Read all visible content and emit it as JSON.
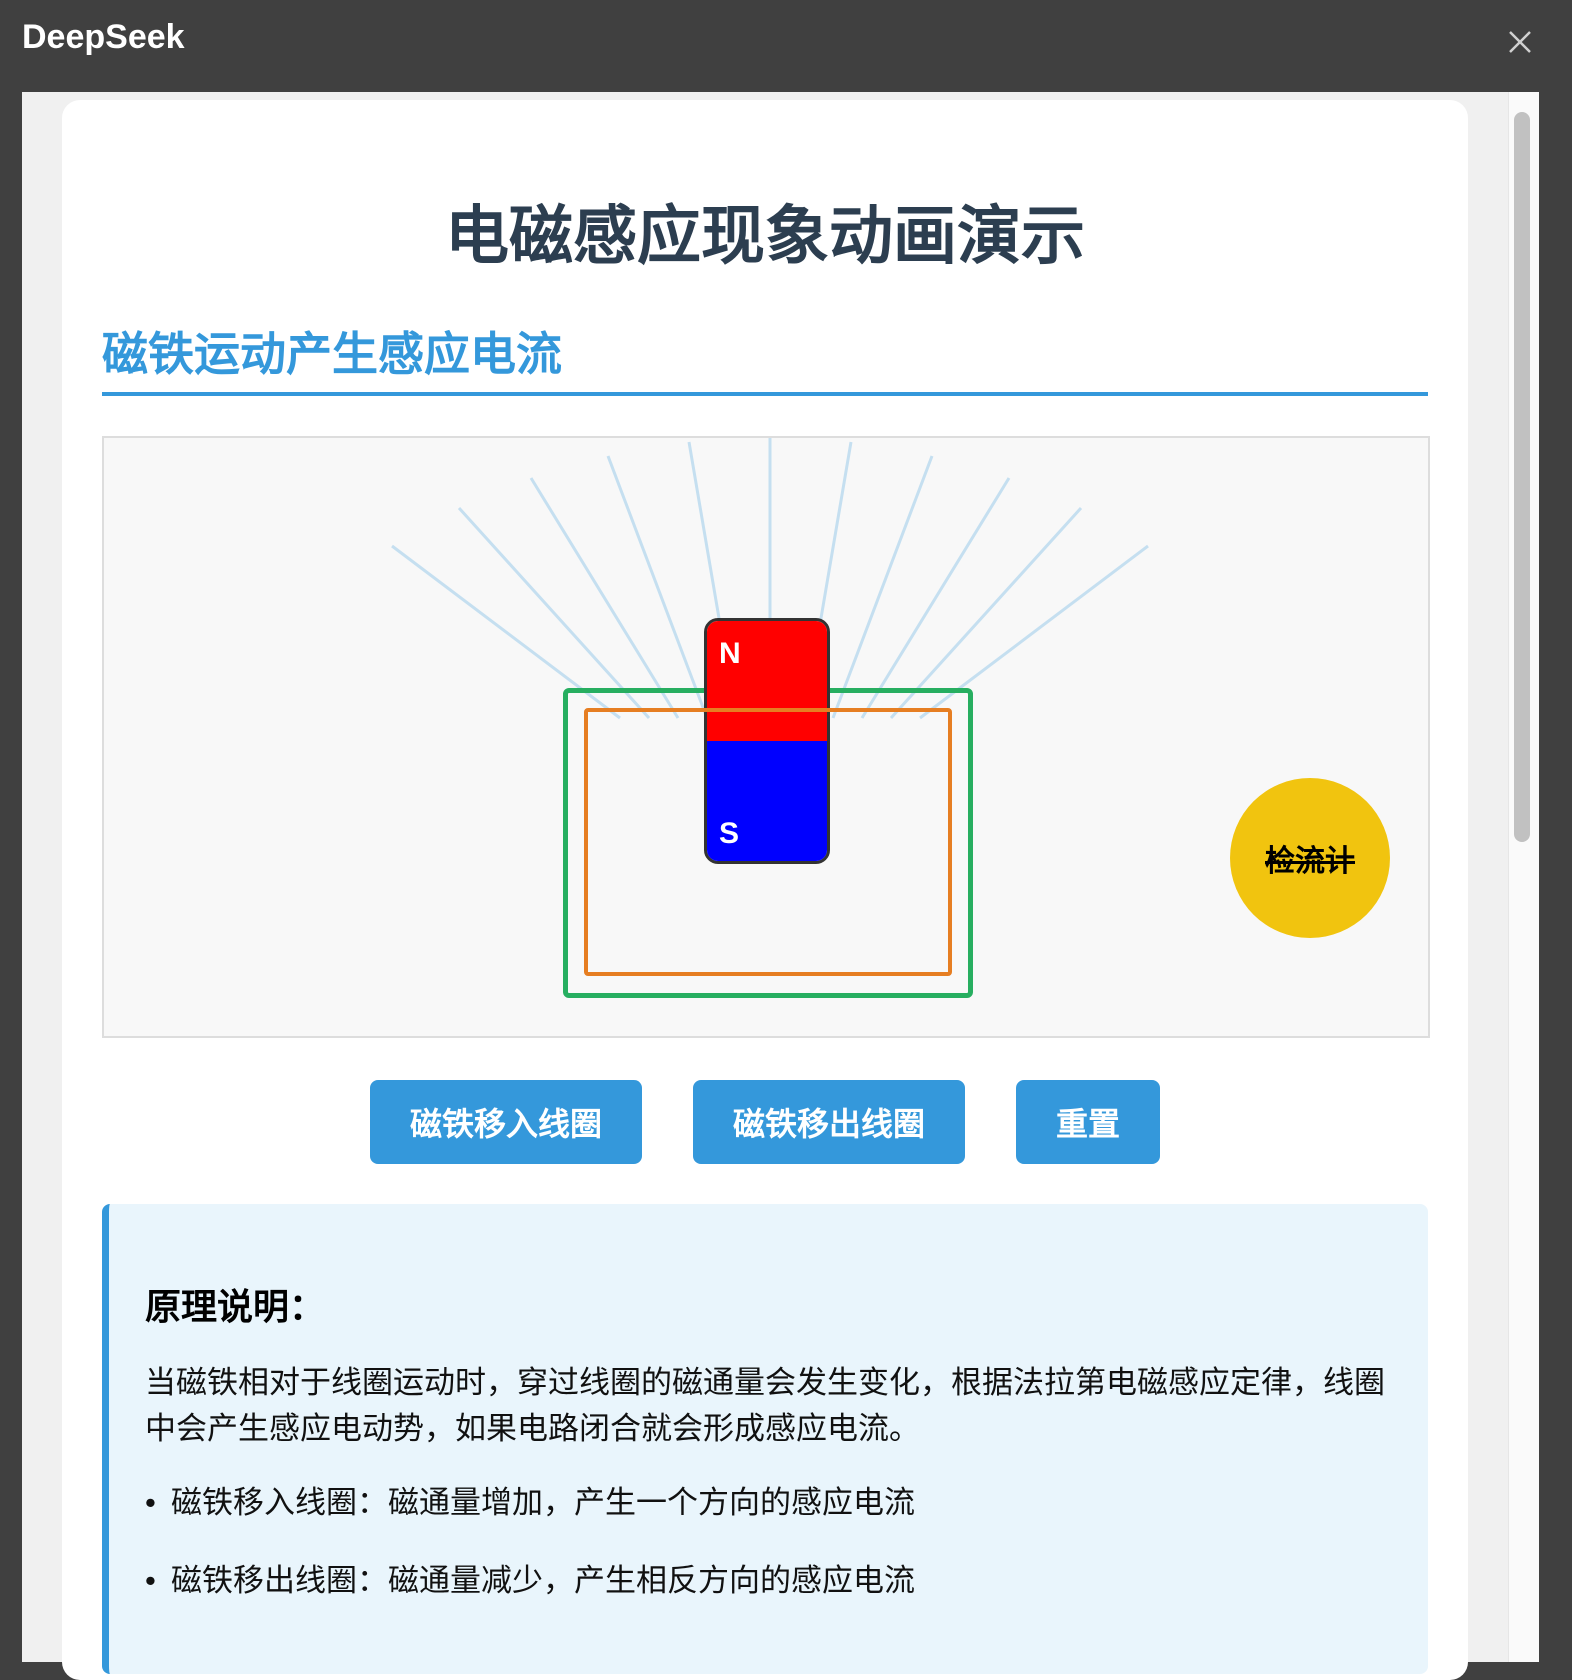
{
  "window": {
    "app_title": "DeepSeek",
    "close_icon": "close-icon"
  },
  "page": {
    "title": "电磁感应现象动画演示",
    "section_title": "磁铁运动产生感应电流"
  },
  "demo": {
    "magnet": {
      "north_label": "N",
      "south_label": "S"
    },
    "galvanometer_label": "检流计",
    "colors": {
      "north": "#ff0000",
      "south": "#0000ff",
      "outer_coil": "#27ae60",
      "inner_coil": "#e67e22",
      "field_lines": "#c5dff0",
      "galvanometer": "#f1c40f"
    }
  },
  "controls": {
    "move_in": "磁铁移入线圈",
    "move_out": "磁铁移出线圈",
    "reset": "重置"
  },
  "explanation": {
    "title": "原理说明：",
    "paragraph": "当磁铁相对于线圈运动时，穿过线圈的磁通量会发生变化，根据法拉第电磁感应定律，线圈中会产生感应电动势，如果电路闭合就会形成感应电流。",
    "items": [
      "磁铁移入线圈：磁通量增加，产生一个方向的感应电流",
      "磁铁移出线圈：磁通量减少，产生相反方向的感应电流"
    ]
  }
}
